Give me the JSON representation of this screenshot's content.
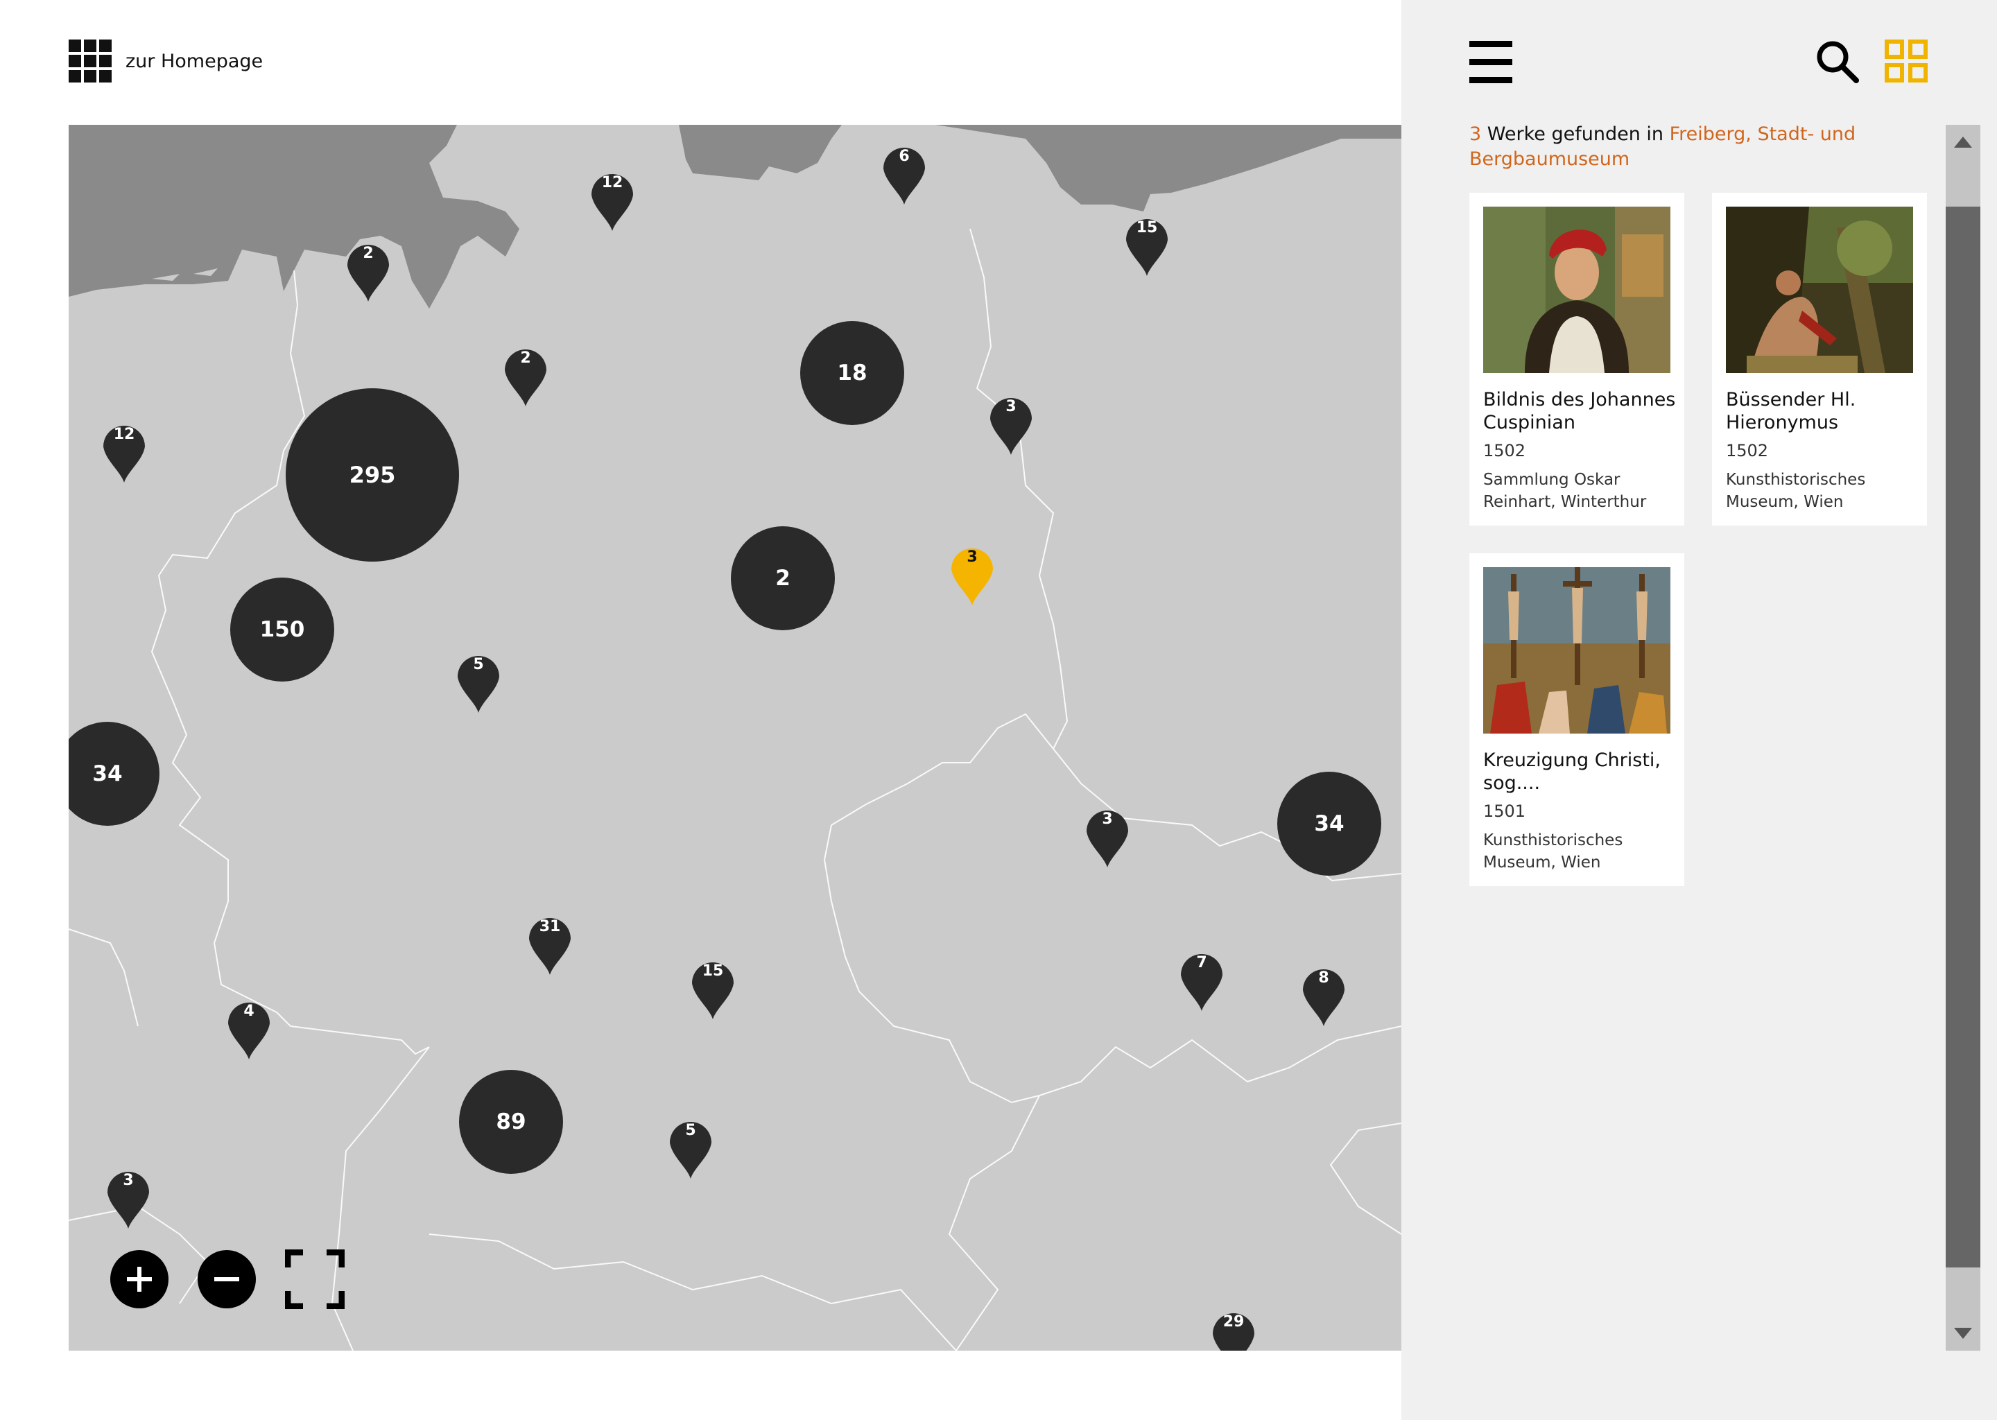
{
  "header": {
    "home_label": "zur Homepage"
  },
  "sidebar": {
    "result": {
      "count": "3",
      "text": " Werke gefunden in ",
      "place": "Freiberg, Stadt- und Bergbaumuseum"
    },
    "cards": [
      {
        "title": "Bildnis des Johannes Cuspinian",
        "year": "1502",
        "location": "Sammlung Oskar Reinhart, Winterthur"
      },
      {
        "title": "Büssender Hl. Hieronymus",
        "year": "1502",
        "location": "Kunsthistorisches Museum, Wien"
      },
      {
        "title": "Kreuzigung Christi, sog....",
        "year": "1501",
        "location": "Kunsthistorisches Museum, Wien"
      }
    ]
  },
  "map": {
    "clusters": [
      {
        "label": "295"
      },
      {
        "label": "150"
      },
      {
        "label": "18"
      },
      {
        "label": "2"
      },
      {
        "label": "34"
      },
      {
        "label": "34"
      },
      {
        "label": "89"
      }
    ],
    "pins": [
      {
        "label": "12"
      },
      {
        "label": "6"
      },
      {
        "label": "15"
      },
      {
        "label": "2"
      },
      {
        "label": "2"
      },
      {
        "label": "12"
      },
      {
        "label": "3"
      },
      {
        "label": "3"
      },
      {
        "label": "5"
      },
      {
        "label": "3"
      },
      {
        "label": "31"
      },
      {
        "label": "15"
      },
      {
        "label": "7"
      },
      {
        "label": "8"
      },
      {
        "label": "4"
      },
      {
        "label": "5"
      },
      {
        "label": "3"
      },
      {
        "label": "29"
      }
    ],
    "active_pin": "3"
  },
  "colors": {
    "accent": "#d0661c",
    "active_pin": "#f5b400",
    "marker": "#2a2a2a",
    "land": "#cbcbcb",
    "sea": "#8a8a8a",
    "sidebar_bg": "#f0f0f0",
    "icon_view": "#f0b400"
  },
  "icons": {
    "home": "grid-dots-icon",
    "menu": "hamburger-menu-icon",
    "search": "search-icon",
    "view": "grid-view-icon",
    "zoom_in": "plus-icon",
    "zoom_out": "minus-icon",
    "fullscreen": "fullscreen-icon"
  }
}
